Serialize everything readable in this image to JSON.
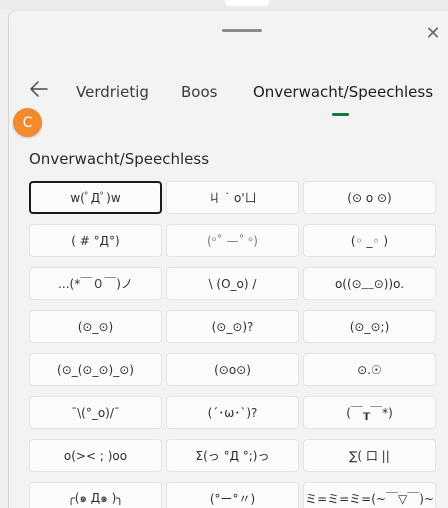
{
  "window": {
    "close_glyph": "✕"
  },
  "tabs": {
    "items": [
      {
        "label": "Verdrietig"
      },
      {
        "label": "Boos"
      },
      {
        "label": "Onverwacht/Speechless"
      }
    ],
    "active_index": 2,
    "accent_color": "#0f7a3a"
  },
  "badge": {
    "label": "C",
    "color": "#f28a2e"
  },
  "section": {
    "title": "Onverwacht/Speechless"
  },
  "kaomoji": [
    "w(ﾟДﾟ)w",
    "ㄐ ˙ o'ㄩ",
    "(⊙ o ⊙)",
    "( # °Д°)",
    "(ᵒ˚ —˚ ᵒ)",
    "(◦ _◦ )",
    "...(*￣０￣)ノ",
    "\\ (O_o) /",
    "o((⊙﹏⊙))o.",
    "(⊙_⊙)",
    "(⊙_⊙)?",
    "(⊙_⊙;)",
    "(⊙_(⊙_⊙)_⊙)",
    "(⊙o⊙)",
    "⊙.☉",
    "ˉ\\(°_o)/ˉ",
    "(´･ω･`)?",
    "(￣┰￣*)",
    "o(>< ; )oo",
    "Σ(っ °Д °;)っ",
    "∑( 口 ||",
    "╭(๑ Д๑ )╮",
    "(°ー°〃)",
    "ミ=ミ=ミ=(~￣▽￣)~"
  ]
}
